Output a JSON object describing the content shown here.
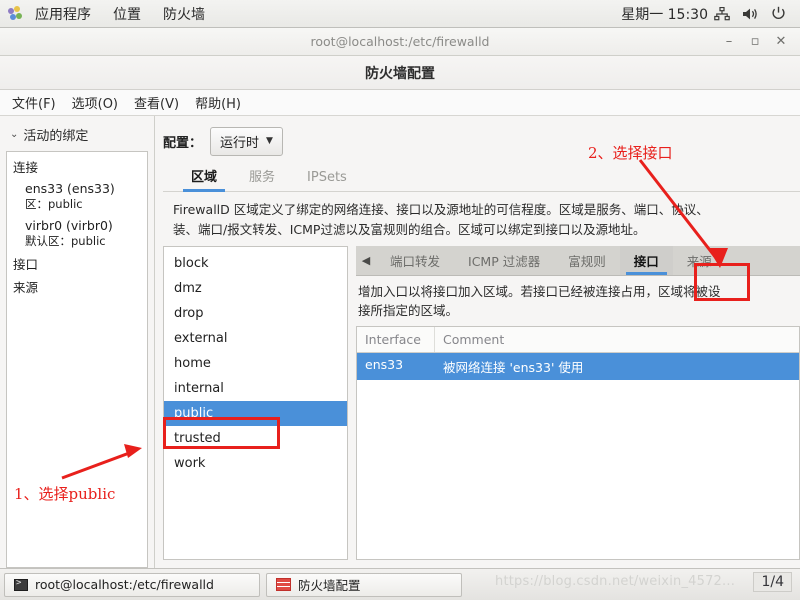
{
  "desktop_panel": {
    "logo_icon": "gnome-logo-icon",
    "items": [
      {
        "label": "应用程序"
      },
      {
        "label": "位置"
      },
      {
        "label": "防火墙"
      }
    ],
    "clock": "星期一  15:30",
    "tray": [
      {
        "icon": "network-icon",
        "glyph": "⛓"
      },
      {
        "icon": "volume-icon",
        "glyph": "🔊"
      },
      {
        "icon": "power-icon",
        "glyph": "⏻"
      }
    ]
  },
  "window": {
    "titlebar_text": "root@localhost:/etc/firewalld",
    "buttons": {
      "minimize": "–",
      "maximize": "▫",
      "close": "✕"
    },
    "app_title": "防火墙配置",
    "menus": [
      {
        "label": "文件(F)"
      },
      {
        "label": "选项(O)"
      },
      {
        "label": "查看(V)"
      },
      {
        "label": "帮助(H)"
      }
    ]
  },
  "sidebar": {
    "header": "活动的绑定",
    "chevron": "⌄",
    "groups": [
      {
        "name": "连接",
        "entries": [
          {
            "name": "ens33 (ens33)",
            "sub": "区：public"
          },
          {
            "name": "virbr0 (virbr0)",
            "sub": "默认区：public"
          }
        ]
      },
      {
        "name": "接口",
        "entries": []
      },
      {
        "name": "来源",
        "entries": []
      }
    ]
  },
  "main": {
    "config_label": "配置：",
    "config_value": "运行时",
    "config_caret": "▼",
    "tabs": [
      {
        "label": "区域",
        "active": true
      },
      {
        "label": "服务",
        "active": false
      },
      {
        "label": "IPSets",
        "active": false
      }
    ],
    "description_lines": [
      "FirewallD 区域定义了绑定的网络连接、接口以及源地址的可信程度。区域是服务、端口、协议、",
      "装、端口/报文转发、ICMP过滤以及富规则的组合。区域可以绑定到接口以及源地址。"
    ],
    "zones": [
      "block",
      "dmz",
      "drop",
      "external",
      "home",
      "internal",
      "public",
      "trusted",
      "work"
    ],
    "selected_zone": "public"
  },
  "right_panel": {
    "scroll_arrow": "◀",
    "subtabs": [
      {
        "label": "端口转发",
        "active": false
      },
      {
        "label": "ICMP 过滤器",
        "active": false
      },
      {
        "label": "富规则",
        "active": false
      },
      {
        "label": "接口",
        "active": true
      },
      {
        "label": "来源",
        "active": false
      }
    ],
    "description_lines": [
      "增加入口以将接口加入区域。若接口已经被连接占用，区域将被设",
      "接所指定的区域。"
    ],
    "table": {
      "headers": [
        "Interface",
        "Comment"
      ],
      "rows": [
        {
          "interface": "ens33",
          "comment": "被网络连接 'ens33' 使用",
          "selected": true
        }
      ]
    }
  },
  "annotations": [
    {
      "id": "step1",
      "text": "1、选择public"
    },
    {
      "id": "step2",
      "text": "2、选择接口"
    }
  ],
  "taskbar": {
    "items": [
      {
        "label": "root@localhost:/etc/firewalld",
        "icon": "terminal-icon"
      },
      {
        "label": "防火墙配置",
        "icon": "firewall-icon"
      }
    ],
    "watermark": "https://blog.csdn.net/weixin_4572...",
    "page_indicator": "1/4"
  },
  "colors": {
    "selection_blue": "#4a90d9",
    "annotation_red": "#e8201c",
    "panel_bg": "#f6f5f4"
  }
}
